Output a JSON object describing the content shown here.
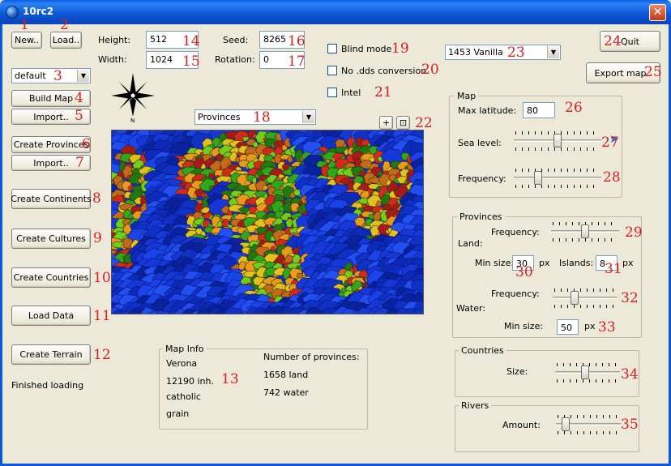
{
  "window": {
    "title": "10rc2",
    "close_glyph": "✕"
  },
  "buttons": {
    "new": "New..",
    "load": "Load..",
    "build_map": "Build Map",
    "import1": "Import..",
    "create_provinces": "Create Provinces",
    "import2": "Import..",
    "create_continents": "Create Continents",
    "create_cultures": "Create Cultures",
    "create_countries": "Create Countries",
    "load_data": "Load Data",
    "create_terrain": "Create Terrain",
    "quit": "Quit",
    "export_map": "Export map..",
    "zoom_plus": "+",
    "zoom_fit": "⊡"
  },
  "fields": {
    "height_label": "Height:",
    "height_value": "512",
    "width_label": "Width:",
    "width_value": "1024",
    "seed_label": "Seed:",
    "seed_value": "8265",
    "rotation_label": "Rotation:",
    "rotation_value": "0"
  },
  "selects": {
    "preset": "default",
    "view": "Provinces",
    "version": "1453 Vanilla"
  },
  "checkboxes": {
    "blind_mode": "Blind mode",
    "no_dds": "No .dds conversion",
    "intel": "Intel"
  },
  "map_group": {
    "title": "Map",
    "max_latitude_label": "Max latitude:",
    "max_latitude_value": "80",
    "sea_level_label": "Sea level:",
    "sea_level_fraction": 0.5,
    "frequency_label": "Frequency:",
    "frequency_fraction": 0.25
  },
  "provinces_group": {
    "title": "Provinces",
    "land_frequency_label": "Frequency:",
    "land_label": "Land:",
    "land_frequency_fraction": 0.5,
    "min_size_label": "Min size:",
    "min_size_value": "30",
    "px1": "px",
    "islands_label": "Islands:",
    "islands_value": "8",
    "px2": "px",
    "water_frequency_label": "Frequency:",
    "water_label": "Water:",
    "water_frequency_fraction": 0.32,
    "water_min_size_label": "Min size:",
    "water_min_size_value": "50",
    "px3": "px"
  },
  "countries_group": {
    "title": "Countries",
    "size_label": "Size:",
    "size_fraction": 0.45
  },
  "rivers_group": {
    "title": "Rivers",
    "amount_label": "Amount:",
    "amount_fraction": 0.1
  },
  "map_info": {
    "title": "Map Info",
    "name": "Verona",
    "population": "12190 inh.",
    "religion": "catholic",
    "goods": "grain",
    "provinces_heading": "Number of provinces:",
    "land": "1658 land",
    "water": "742 water"
  },
  "status": "Finished loading",
  "annotations": [
    "1",
    "2",
    "3",
    "4",
    "5",
    "6",
    "7",
    "8",
    "9",
    "10",
    "11",
    "12",
    "13",
    "14",
    "15",
    "16",
    "17",
    "18",
    "19",
    "20",
    "21",
    "22",
    "23",
    "24",
    "25",
    "26",
    "27",
    "28",
    "29",
    "30",
    "31",
    "32",
    "33",
    "34",
    "35"
  ],
  "colors": {
    "titlebar": "#0b57d9",
    "annotation": "#d61f1f",
    "ocean": "#1030c8"
  }
}
